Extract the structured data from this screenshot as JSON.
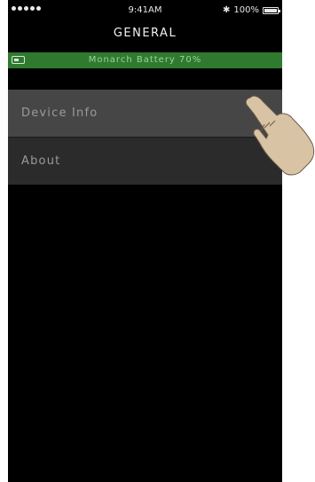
{
  "status_bar": {
    "time": "9:41AM",
    "battery_percent": "100%",
    "bluetooth_icon": "bluetooth-icon",
    "battery_icon": "battery-icon"
  },
  "header": {
    "title": "GENERAL"
  },
  "battery_banner": {
    "text": "Monarch Battery 70%",
    "icon": "battery-icon",
    "color": "#2f7a2f"
  },
  "menu": {
    "items": [
      {
        "label": "Device Info",
        "highlighted": true
      },
      {
        "label": "About",
        "highlighted": false
      }
    ]
  },
  "overlay": {
    "icon": "tapping-hand-icon"
  }
}
